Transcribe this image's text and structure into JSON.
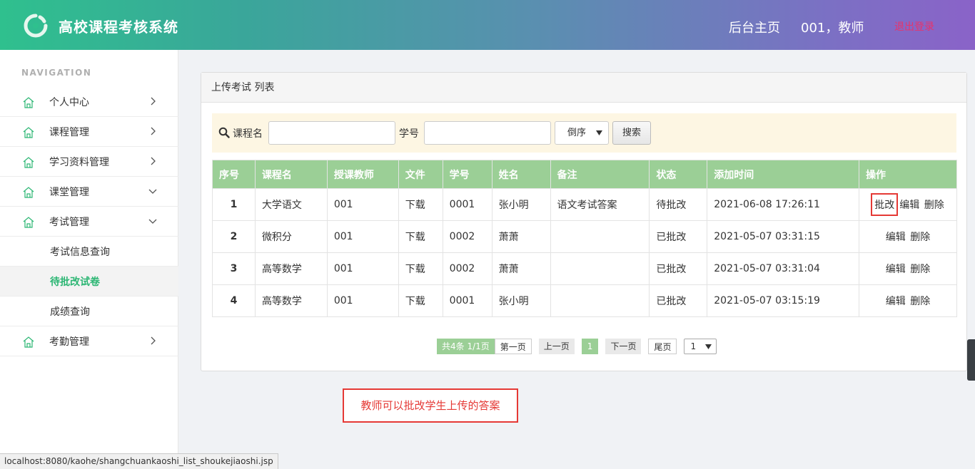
{
  "header": {
    "app_title": "高校课程考核系统",
    "home_link": "后台主页",
    "user_info": "001，教师",
    "logout": "退出登录"
  },
  "sidebar": {
    "nav_heading": "NAVIGATION",
    "items": [
      {
        "label": "个人中心",
        "arrow": "chevron-right"
      },
      {
        "label": "课程管理",
        "arrow": "chevron-right"
      },
      {
        "label": "学习资料管理",
        "arrow": "chevron-right"
      },
      {
        "label": "课堂管理",
        "arrow": "chevron-down"
      },
      {
        "label": "考试管理",
        "arrow": "chevron-down"
      },
      {
        "label": "考试信息查询"
      },
      {
        "label": "待批改试卷",
        "active": true
      },
      {
        "label": "成绩查询"
      },
      {
        "label": "考勤管理",
        "arrow": "chevron-right"
      }
    ]
  },
  "panel": {
    "title": "上传考试 列表"
  },
  "search": {
    "course_label": "课程名",
    "course_value": "",
    "student_label": "学号",
    "student_value": "",
    "order_selected": "倒序",
    "button": "搜索"
  },
  "table": {
    "headers": [
      "序号",
      "课程名",
      "授课教师",
      "文件",
      "学号",
      "姓名",
      "备注",
      "状态",
      "添加时间",
      "操作"
    ],
    "rows": [
      {
        "idx": "1",
        "course": "大学语文",
        "teacher": "001",
        "file": "下载",
        "sid": "0001",
        "name": "张小明",
        "remark": "语文考试答案",
        "status": "待批改",
        "time": "2021-06-08 17:26:11",
        "review": "批改",
        "edit": "编辑",
        "delete": "删除"
      },
      {
        "idx": "2",
        "course": "微积分",
        "teacher": "001",
        "file": "下载",
        "sid": "0002",
        "name": "萧萧",
        "remark": "",
        "status": "已批改",
        "time": "2021-05-07 03:31:15",
        "edit": "编辑",
        "delete": "删除"
      },
      {
        "idx": "3",
        "course": "高等数学",
        "teacher": "001",
        "file": "下载",
        "sid": "0002",
        "name": "萧萧",
        "remark": "",
        "status": "已批改",
        "time": "2021-05-07 03:31:04",
        "edit": "编辑",
        "delete": "删除"
      },
      {
        "idx": "4",
        "course": "高等数学",
        "teacher": "001",
        "file": "下载",
        "sid": "0001",
        "name": "张小明",
        "remark": "",
        "status": "已批改",
        "time": "2021-05-07 03:15:19",
        "edit": "编辑",
        "delete": "删除"
      }
    ]
  },
  "pager": {
    "info": "共4条  1/1页",
    "first": "第一页",
    "prev": "上一页",
    "current": "1",
    "next": "下一页",
    "last": "尾页",
    "page_select": "1"
  },
  "annotation": "教师可以批改学生上传的答案",
  "status_url": "localhost:8080/kaohe/shangchuankaoshi_list_shoukejiaoshi.jsp",
  "colors": {
    "accent_green": "#2bb673",
    "table_header": "#9bcf96",
    "highlight_red": "#e53935",
    "logout_pink": "#e8336b"
  }
}
